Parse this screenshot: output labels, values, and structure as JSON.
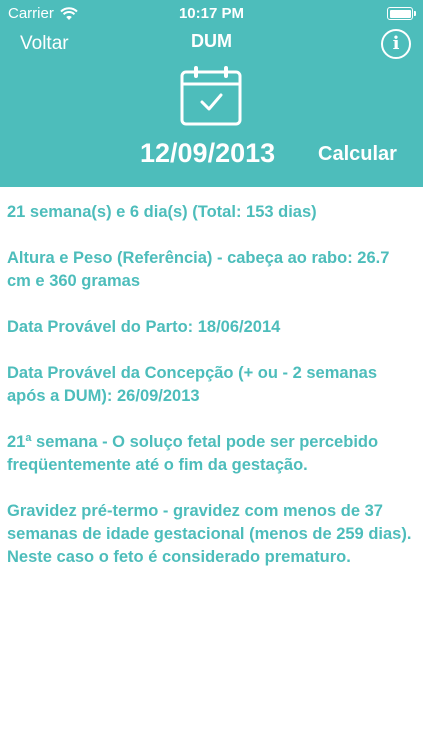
{
  "status_bar": {
    "carrier": "Carrier",
    "time": "10:17 PM"
  },
  "nav": {
    "back_label": "Voltar",
    "title": "DUM",
    "info_label": "i"
  },
  "date_picker": {
    "date": "12/09/2013",
    "calculate_label": "Calcular"
  },
  "results": [
    "21 semana(s) e 6 dia(s) (Total: 153 dias)",
    "Altura e Peso (Referência) - cabeça ao rabo: 26.7 cm e 360 gramas",
    "Data Provável do Parto: 18/06/2014",
    "Data Provável da Concepção (+ ou - 2 semanas após a DUM): 26/09/2013",
    "21ª semana - O soluço fetal pode ser percebido freqüentemente até o fim da gestação.",
    "Gravidez pré-termo - gravidez com menos de 37 semanas de idade gestacional (menos de 259 dias). Neste caso o feto é considerado prematuro."
  ],
  "colors": {
    "accent": "#4dbdbb",
    "background": "#ffffff"
  },
  "icons": {
    "wifi": "wifi-icon",
    "battery": "battery-icon",
    "info": "info-icon",
    "calendar": "calendar-check-icon"
  }
}
